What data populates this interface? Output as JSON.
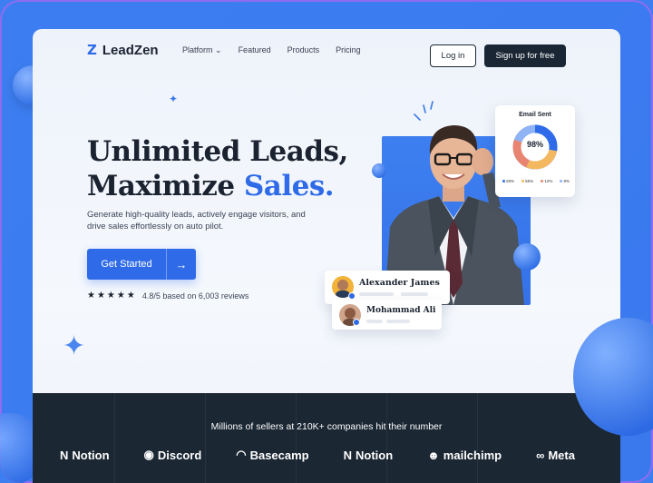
{
  "nav": {
    "logo_mark": "Z",
    "logo_text": "LeadZen",
    "links": [
      "Platform ⌄",
      "Featured",
      "Products",
      "Pricing"
    ],
    "login": "Log in",
    "signup": "Sign up for free"
  },
  "hero": {
    "headline_line1": "Unlimited Leads,",
    "headline_line2_a": "Maximize ",
    "headline_line2_b": "Sales.",
    "subtext": "Generate high-quality leads, actively engage visitors, and drive sales effortlessly on auto pilot.",
    "cta_label": "Get Started",
    "cta_arrow": "→",
    "stars": "★★★★★",
    "rating_text": "4.8/5 based on 6,003 reviews"
  },
  "email_card": {
    "title": "Email Sent",
    "percent": "98%",
    "legend": [
      {
        "value": "28%",
        "color": "#2f6be8"
      },
      {
        "value": "56%",
        "color": "#f4b860"
      },
      {
        "value": "12%",
        "color": "#e98470"
      },
      {
        "value": "8%",
        "color": "#8fb3f5"
      }
    ]
  },
  "users": [
    {
      "name": "Alexander James"
    },
    {
      "name": "Mohammad Ali"
    }
  ],
  "logos": {
    "title": "Millions of sellers at 210K+ companies hit their number",
    "brands": [
      {
        "icon": "notion-icon",
        "glyph": "N",
        "name": "Notion"
      },
      {
        "icon": "discord-icon",
        "glyph": "◉",
        "name": "Discord"
      },
      {
        "icon": "basecamp-icon",
        "glyph": "◠",
        "name": "Basecamp"
      },
      {
        "icon": "notion-icon",
        "glyph": "N",
        "name": "Notion"
      },
      {
        "icon": "mailchimp-icon",
        "glyph": "☻",
        "name": "mailchimp"
      },
      {
        "icon": "meta-icon",
        "glyph": "∞",
        "name": "Meta"
      }
    ]
  }
}
